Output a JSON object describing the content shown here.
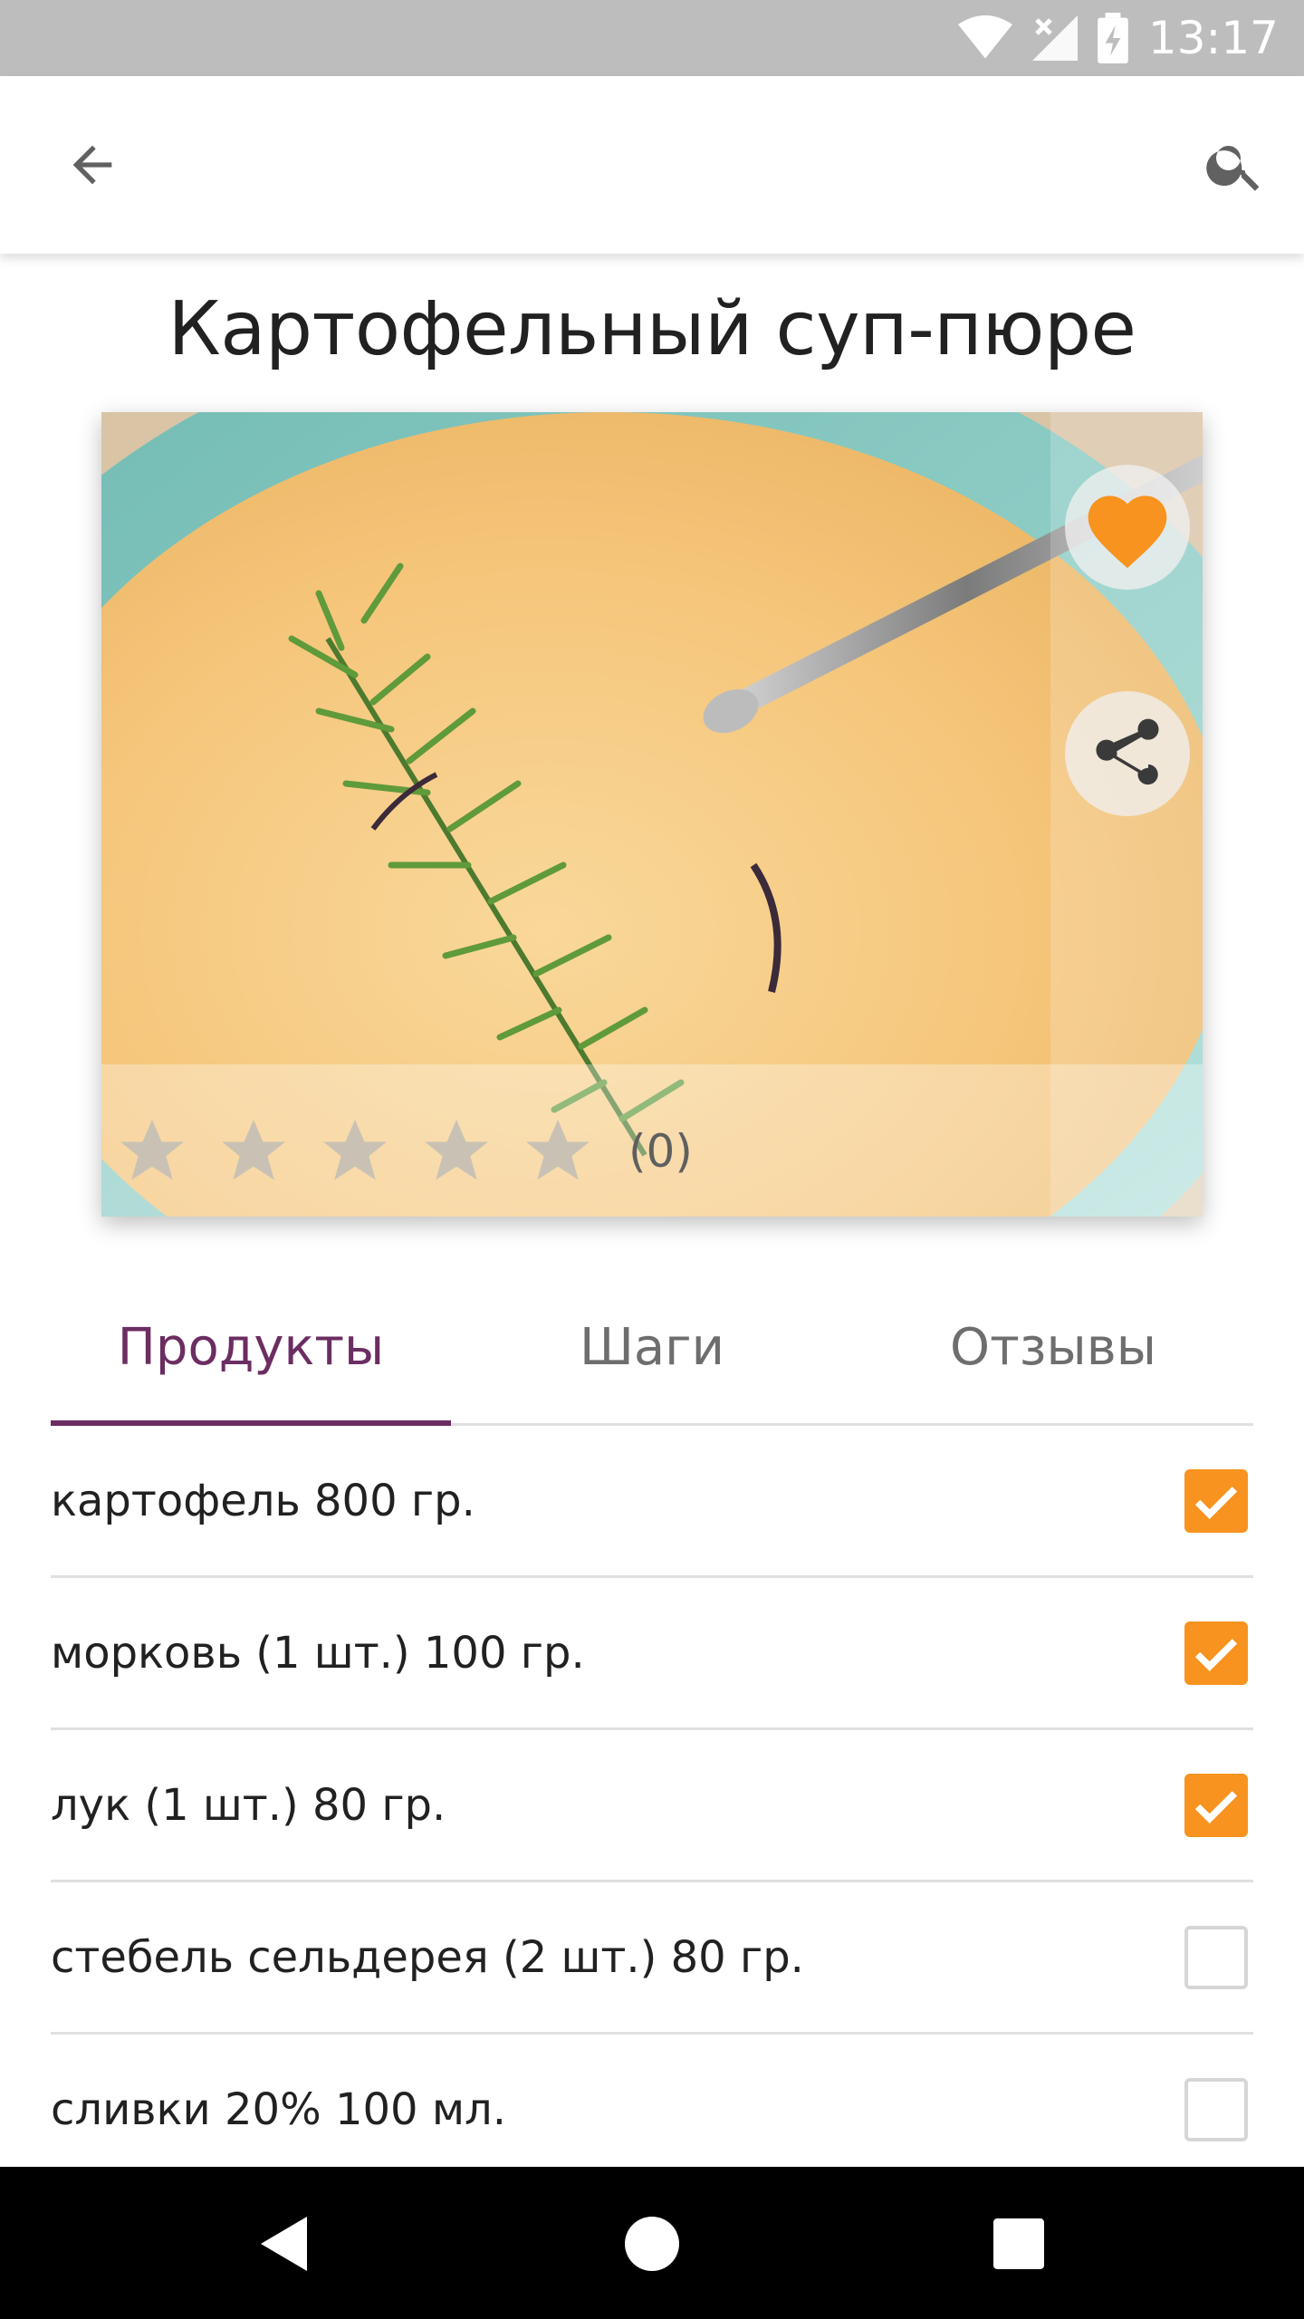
{
  "status_bar": {
    "time": "13:17",
    "icons": [
      "wifi-icon",
      "signal-icon",
      "battery-charging-icon"
    ]
  },
  "toolbar": {
    "back_icon": "arrow-back-icon",
    "search_icon": "search-icon"
  },
  "recipe": {
    "title": "Картофельный суп-пюре",
    "image_alt": "soup-photo",
    "rating_count": "(0)",
    "rating_stars": 0,
    "favorite_color": "#f7931e"
  },
  "tabs": [
    {
      "label": "Продукты",
      "active": true
    },
    {
      "label": "Шаги",
      "active": false
    },
    {
      "label": "Отзывы",
      "active": false
    }
  ],
  "ingredients": [
    {
      "label": "картофель 800 гр.",
      "checked": true
    },
    {
      "label": "морковь (1 шт.) 100 гр.",
      "checked": true
    },
    {
      "label": "лук (1 шт.) 80 гр.",
      "checked": true
    },
    {
      "label": "стебель сельдерея (2 шт.) 80 гр.",
      "checked": false
    },
    {
      "label": "сливки 20% 100 мл.",
      "checked": false
    }
  ],
  "colors": {
    "accent": "#6b2d62",
    "checkbox": "#f7931e",
    "statusbar": "#bdbdbd"
  },
  "nav_bar": {
    "icons": [
      "back-triangle-icon",
      "home-circle-icon",
      "recents-square-icon"
    ]
  }
}
